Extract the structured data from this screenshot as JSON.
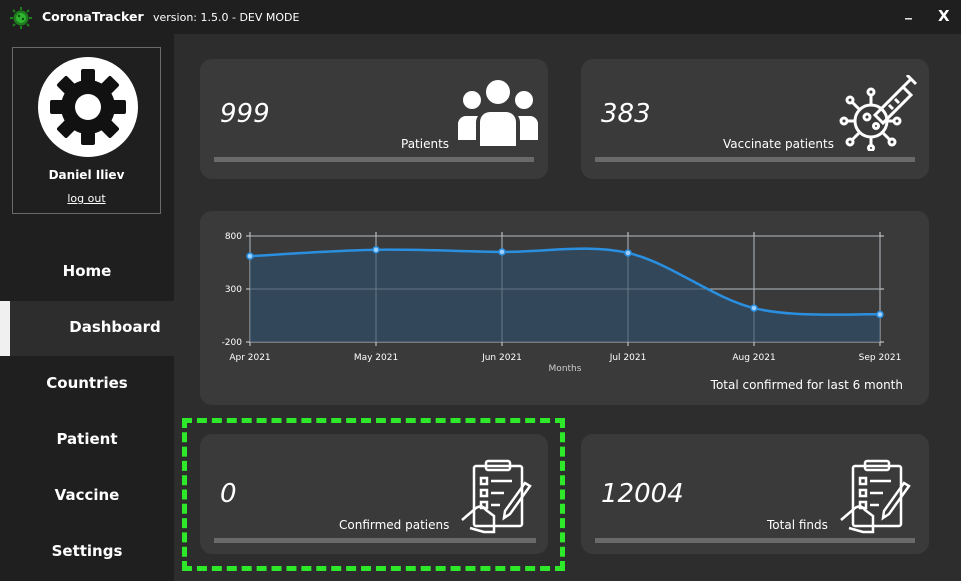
{
  "app": {
    "title": "CoronaTracker",
    "version": "version: 1.5.0 - DEV MODE",
    "minimize_label": "_",
    "close_label": "X"
  },
  "profile": {
    "name": "Daniel Iliev",
    "logout_label": "log out"
  },
  "sidebar": {
    "items": [
      {
        "label": "Home",
        "active": false
      },
      {
        "label": "Dashboard",
        "active": true
      },
      {
        "label": "Countries",
        "active": false
      },
      {
        "label": "Patient",
        "active": false
      },
      {
        "label": "Vaccine",
        "active": false
      },
      {
        "label": "Settings",
        "active": false
      }
    ]
  },
  "cards": {
    "patients": {
      "value": "999",
      "label": "Patients",
      "icon": "group-icon"
    },
    "vaccinated": {
      "value": "383",
      "label": "Vaccinate patients",
      "icon": "virus-syringe-icon"
    },
    "confirmed": {
      "value": "0",
      "label": "Confirmed patiens",
      "icon": "clipboard-checklist-icon"
    },
    "total": {
      "value": "12004",
      "label": "Total finds",
      "icon": "clipboard-checklist-icon"
    }
  },
  "chart_data": {
    "type": "area",
    "x": [
      "Apr 2021",
      "May 2021",
      "Jun 2021",
      "Jul 2021",
      "Aug 2021",
      "Sep 2021"
    ],
    "values": [
      610,
      670,
      650,
      640,
      120,
      60
    ],
    "ylim": [
      -200,
      800
    ],
    "yticks": [
      "800",
      "300",
      "-200"
    ],
    "xlabel": "Months",
    "caption": "Total confirmed for last 6 month",
    "grid": true,
    "color": "#2b8fe0",
    "fill": "#324a5e"
  },
  "colors": {
    "background": "#2d2d2d",
    "sidebar": "#1f1f1f",
    "card": "#3a3a3a",
    "highlight": "#2ee82a"
  }
}
